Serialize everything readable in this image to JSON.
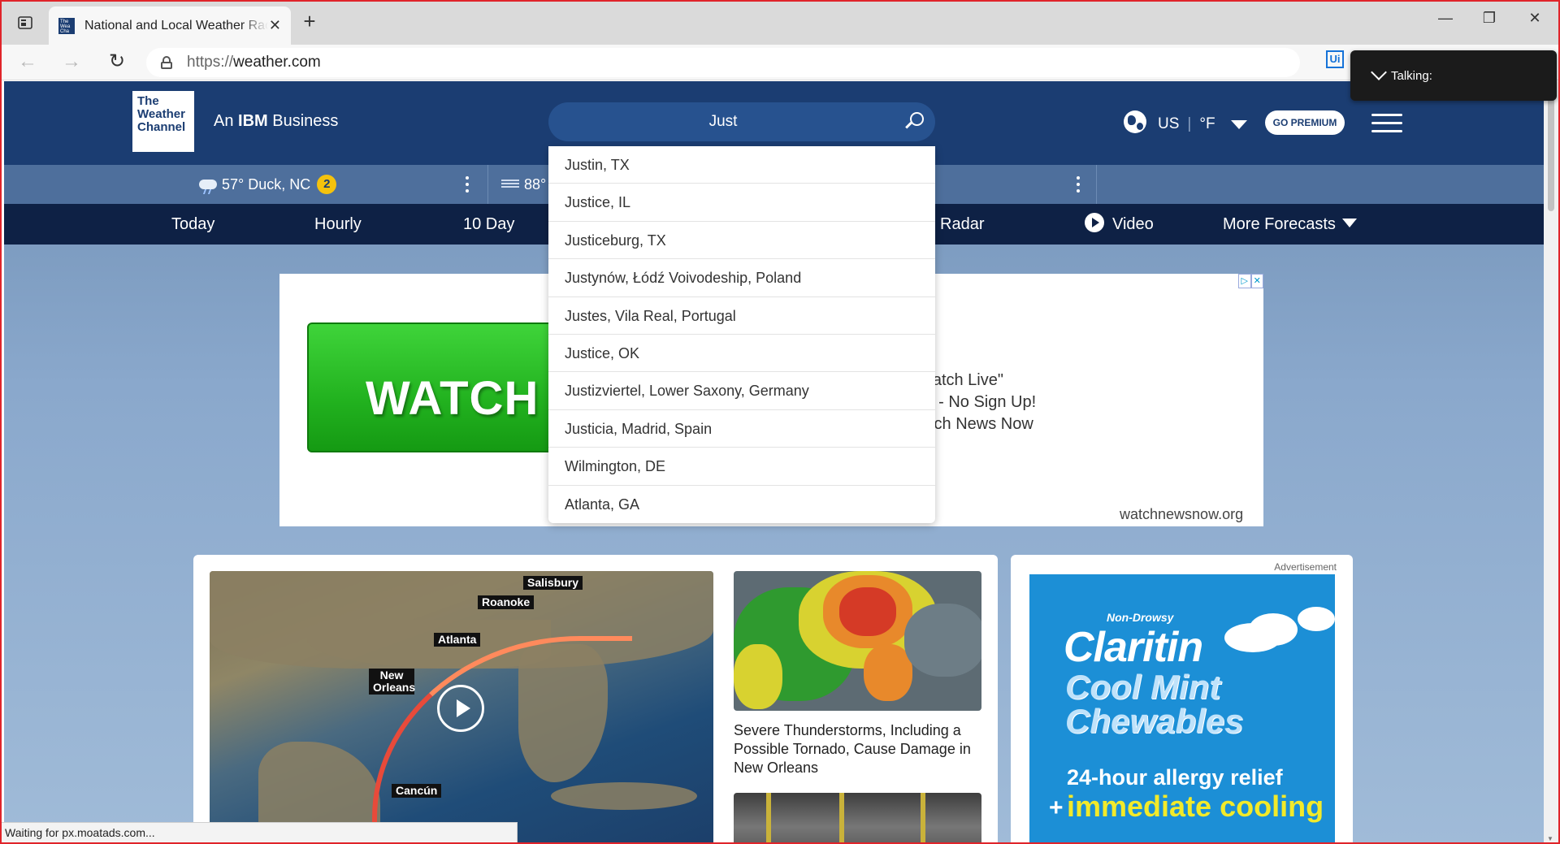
{
  "browser": {
    "tab_title": "National and Local Weather Radar",
    "url_protocol": "https://",
    "url_host": "weather.com",
    "new_tab_label": "+",
    "minimize": "—",
    "restore": "❐",
    "close": "✕",
    "ext_label": "Ui",
    "status_text": "Waiting for px.moatads.com...",
    "talking_label": "Talking:"
  },
  "header": {
    "logo_lines": [
      "The",
      "Weather",
      "Channel"
    ],
    "tagline_prefix": "An ",
    "tagline_brand": "IBM",
    "tagline_suffix": " Business",
    "search_value": "Just",
    "locale": "US",
    "temp_unit": "°F",
    "premium_label": "GO PREMIUM"
  },
  "subbar": {
    "item1_temp": "57°",
    "item1_location": "Duck, NC",
    "item1_alerts": "2",
    "item2_temp": "88°"
  },
  "nav": {
    "items": [
      "Today",
      "Hourly",
      "10 Day",
      "Radar",
      "Video",
      "More Forecasts"
    ]
  },
  "search_suggestions": [
    "Justin, TX",
    "Justice, IL",
    "Justiceburg, TX",
    "Justynów, Łódź Voivodeship, Poland",
    "Justes, Vila Real, Portugal",
    "Justice, OK",
    "Justizviertel, Lower Saxony, Germany",
    "Justicia, Madrid, Spain",
    "Wilmington, DE",
    "Atlanta, GA"
  ],
  "ad_banner": {
    "button_text": "WATCH L",
    "copy_lines": [
      "'atch Live\"",
      "; - No Sign Up!",
      "tch News Now"
    ],
    "domain": "watchnewsnow.org"
  },
  "main_card": {
    "map_cities": [
      "Salisbury",
      "Roanoke",
      "Atlanta",
      "New Orleans",
      "Cancún"
    ],
    "story_title": "Severe Thunderstorms, Including a Possible Tornado, Cause Damage in New Orleans"
  },
  "side_ad": {
    "label": "Advertisement",
    "tag": "Non-Drowsy",
    "brand": "Claritin",
    "product_line1": "Cool Mint",
    "product_line2": "Chewables",
    "relief": "24-hour allergy relief",
    "plus": "+",
    "immediate": "immediate cooling"
  },
  "colors": {
    "header_bg": "#1b3d72",
    "subbar_bg": "#4e6f9c",
    "nav_bg": "#0e2145",
    "search_bg": "#27528f",
    "alert_badge": "#f4c20d",
    "watch_green": "#22b21f"
  }
}
